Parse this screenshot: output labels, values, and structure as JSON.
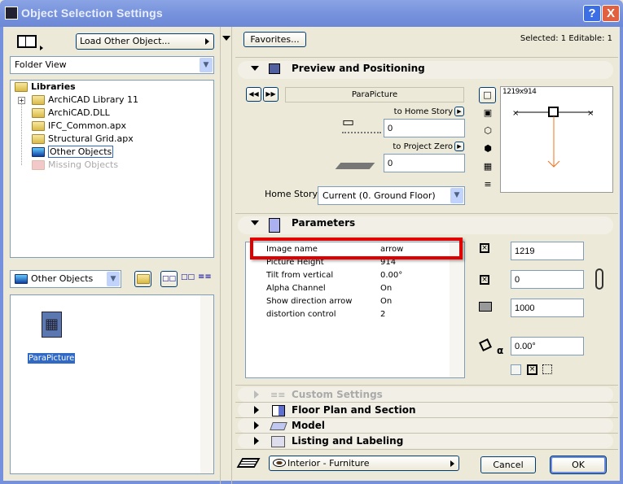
{
  "window": {
    "title": "Object Selection Settings",
    "help": "?",
    "close": "X"
  },
  "left": {
    "load_button": "Load Other Object...",
    "view_select": "Folder View",
    "tree": {
      "root": "Libraries",
      "items": [
        {
          "label": "ArchiCAD Library 11",
          "expandable": true
        },
        {
          "label": "ArchiCAD.DLL"
        },
        {
          "label": "IFC_Common.apx"
        },
        {
          "label": "Structural Grid.apx"
        },
        {
          "label": "Other Objects",
          "selected": true
        },
        {
          "label": "Missing Objects",
          "disabled": true
        }
      ]
    },
    "folder_select": "Other Objects",
    "objects": [
      {
        "label": "ParaPicture",
        "selected": true
      }
    ]
  },
  "right": {
    "favorites": "Favorites...",
    "selection_info": "Selected: 1 Editable: 1",
    "preview": {
      "title": "Preview and Positioning",
      "object_name": "ParaPicture",
      "to_home_story_label": "to Home Story",
      "to_home_story_value": "0",
      "to_project_zero_label": "to Project Zero",
      "to_project_zero_value": "0",
      "home_story_label": "Home Story:",
      "home_story_value": "Current (0. Ground Floor)",
      "preview_size": "1219x914"
    },
    "parameters": {
      "title": "Parameters",
      "rows": [
        {
          "name": "Image name",
          "value": "arrow"
        },
        {
          "name": "Picture Height",
          "value": "914"
        },
        {
          "name": "Tilt from vertical",
          "value": "0.00°"
        },
        {
          "name": "Alpha Channel",
          "value": "On"
        },
        {
          "name": "Show direction arrow",
          "value": "On"
        },
        {
          "name": "distortion control",
          "value": "2"
        }
      ],
      "width": "1219",
      "depth": "0",
      "elevation": "1000",
      "angle": "0.00°"
    },
    "sections": [
      {
        "label": "Custom Settings",
        "disabled": true
      },
      {
        "label": "Floor Plan and Section"
      },
      {
        "label": "Model"
      },
      {
        "label": "Listing and Labeling"
      }
    ],
    "layer": "Interior - Furniture",
    "cancel": "Cancel",
    "ok": "OK"
  },
  "colors": {
    "highlight": "#316ac5",
    "red_box": "#e00000",
    "arrow": "#f07020"
  }
}
